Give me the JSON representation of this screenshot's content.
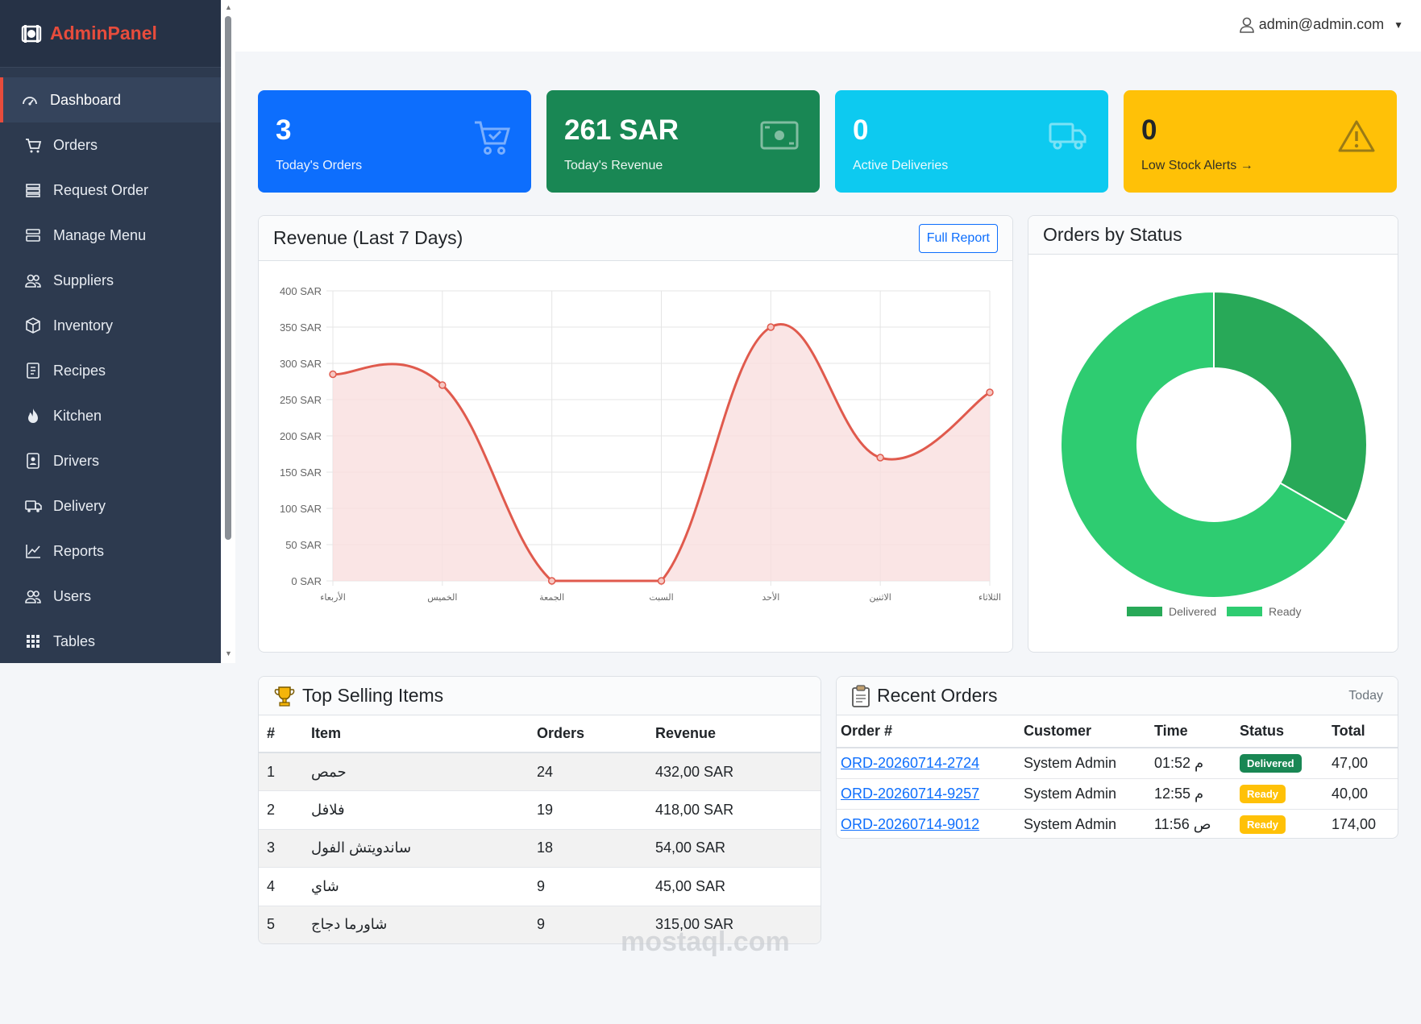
{
  "brand": {
    "name": "AdminPanel"
  },
  "sidebar": {
    "items": [
      {
        "label": "Dashboard",
        "icon": "gauge-icon",
        "active": true
      },
      {
        "label": "Orders",
        "icon": "cart-icon"
      },
      {
        "label": "Request Order",
        "icon": "stack-icon"
      },
      {
        "label": "Manage Menu",
        "icon": "menu-stack-icon"
      },
      {
        "label": "Suppliers",
        "icon": "people-icon"
      },
      {
        "label": "Inventory",
        "icon": "box-icon"
      },
      {
        "label": "Recipes",
        "icon": "book-icon"
      },
      {
        "label": "Kitchen",
        "icon": "flame-icon"
      },
      {
        "label": "Drivers",
        "icon": "id-badge-icon"
      },
      {
        "label": "Delivery",
        "icon": "truck-icon"
      },
      {
        "label": "Reports",
        "icon": "graph-icon"
      },
      {
        "label": "Users",
        "icon": "people-icon"
      },
      {
        "label": "Tables",
        "icon": "grid-icon"
      }
    ]
  },
  "header": {
    "user": "admin@admin.com"
  },
  "stats": [
    {
      "value": "3",
      "label": "Today's Orders",
      "color": "#0d6efd",
      "text": "#ffffff",
      "icon": "cart-check-icon"
    },
    {
      "value": "261 SAR",
      "label": "Today's Revenue",
      "color": "#198754",
      "text": "#ffffff",
      "icon": "cash-icon"
    },
    {
      "value": "0",
      "label": "Active Deliveries",
      "color": "#0dcaf0",
      "text": "#ffffff",
      "icon": "truck-icon"
    },
    {
      "value": "0",
      "label": "Low Stock Alerts →",
      "color": "#ffc107",
      "text": "#212529",
      "icon": "warning-icon"
    }
  ],
  "revenue": {
    "title": "Revenue (Last 7 Days)",
    "button": "Full Report"
  },
  "orders_status": {
    "title": "Orders by Status"
  },
  "chart_data": [
    {
      "type": "area",
      "title": "Revenue (Last 7 Days)",
      "categories": [
        "الأربعاء",
        "الخميس",
        "الجمعة",
        "السبت",
        "الأحد",
        "الاثنين",
        "الثلاثاء"
      ],
      "values": [
        285,
        270,
        0,
        0,
        350,
        170,
        260
      ],
      "ylim": [
        0,
        400
      ],
      "yticks": [
        "0 SAR",
        "50 SAR",
        "100 SAR",
        "150 SAR",
        "200 SAR",
        "250 SAR",
        "300 SAR",
        "350 SAR",
        "400 SAR"
      ],
      "line_color": "#e05a4d",
      "fill_color": "#f9dede",
      "grid": true
    },
    {
      "type": "pie",
      "title": "Orders by Status",
      "labels": [
        "Delivered",
        "Ready"
      ],
      "values": [
        1,
        2
      ],
      "colors": [
        "#28a958",
        "#2ecc71"
      ],
      "legend": "bottom"
    }
  ],
  "top_selling": {
    "title": "Top Selling Items",
    "headers": [
      "#",
      "Item",
      "Orders",
      "Revenue"
    ],
    "rows": [
      [
        "1",
        "حمص",
        "24",
        "432,00 SAR"
      ],
      [
        "2",
        "فلافل",
        "19",
        "418,00 SAR"
      ],
      [
        "3",
        "ساندويتش الفول",
        "18",
        "54,00 SAR"
      ],
      [
        "4",
        "شاي",
        "9",
        "45,00 SAR"
      ],
      [
        "5",
        "شاورما دجاج",
        "9",
        "315,00 SAR"
      ]
    ]
  },
  "recent_orders": {
    "title": "Recent Orders",
    "period": "Today",
    "headers": [
      "Order #",
      "Customer",
      "Time",
      "Status",
      "Total"
    ],
    "rows": [
      {
        "order": "ORD-20260714-2724",
        "customer": "System Admin",
        "time": "01:52 م",
        "status": "Delivered",
        "status_color": "#198754",
        "total": "47,00"
      },
      {
        "order": "ORD-20260714-9257",
        "customer": "System Admin",
        "time": "12:55 م",
        "status": "Ready",
        "status_color": "#ffc107",
        "total": "40,00"
      },
      {
        "order": "ORD-20260714-9012",
        "customer": "System Admin",
        "time": "11:56 ص",
        "status": "Ready",
        "status_color": "#ffc107",
        "total": "174,00"
      }
    ]
  },
  "watermark": "mostaql.com"
}
